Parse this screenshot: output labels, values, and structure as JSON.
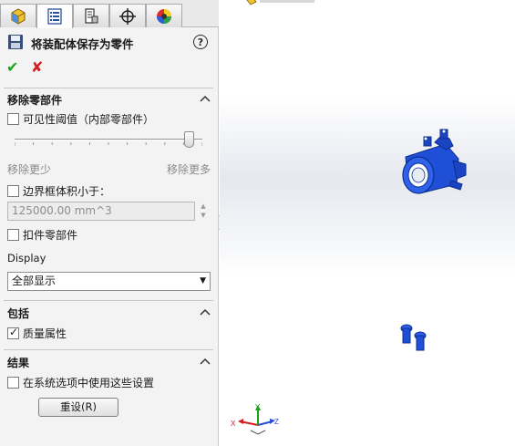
{
  "tabs": [
    {
      "name": "feature-manager",
      "icon": "feature-tree-icon"
    },
    {
      "name": "property-manager",
      "icon": "property-list-icon"
    },
    {
      "name": "configuration-manager",
      "icon": "configuration-icon"
    },
    {
      "name": "dimxpert-manager",
      "icon": "crosshair-icon"
    },
    {
      "name": "display-manager",
      "icon": "color-wheel-icon"
    }
  ],
  "property_manager": {
    "title": "将装配体保存为零件",
    "help": "?",
    "ok": "✔",
    "cancel": "✘"
  },
  "remove_parts": {
    "title": "移除零部件",
    "visibility_threshold_label": "可见性阈值（内部零部件）",
    "visibility_threshold_checked": false,
    "slider_left": "移除更少",
    "slider_right": "移除更多",
    "slider_level": 0.93,
    "bbox_label": "边界框体积小于：",
    "bbox_checked": false,
    "bbox_value": "125000.00 mm^3",
    "fastener_label": "扣件零部件",
    "fastener_checked": false,
    "display_label": "Display",
    "display_value": "全部显示"
  },
  "include": {
    "title": "包括",
    "mass_props_label": "质量属性",
    "mass_props_checked": true
  },
  "results": {
    "title": "结果",
    "system_options_label": "在系统选项中使用这些设置",
    "system_options_checked": false,
    "reset_label": "重设(R)"
  },
  "triad": {
    "x": "X",
    "y": "Y",
    "z": "Z"
  },
  "colors": {
    "part_blue": "#1f4fd6",
    "ok_green": "#1aa21a",
    "cancel_red": "#d42020"
  }
}
